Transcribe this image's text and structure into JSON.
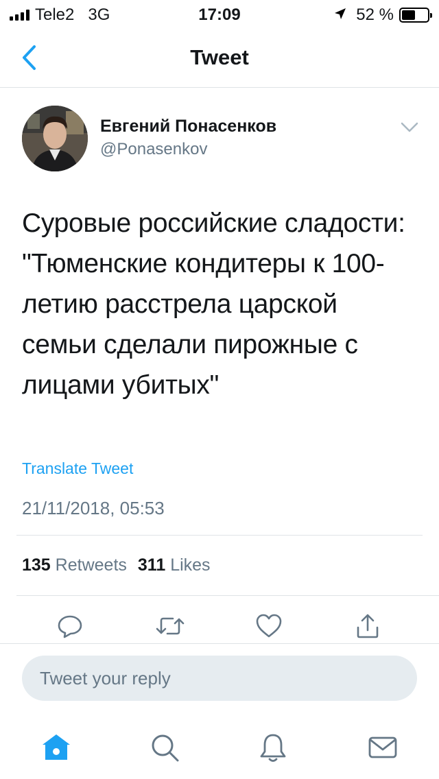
{
  "status_bar": {
    "carrier": "Tele2",
    "network": "3G",
    "time": "17:09",
    "battery": "52 %",
    "battery_level": 0.52
  },
  "nav": {
    "title": "Tweet",
    "back_icon": "chevron-left-icon"
  },
  "tweet": {
    "author_name": "Евгений Понасенков",
    "author_handle": "@Ponasenkov",
    "text": "Суровые российские сладости: \"Тюменские кондитеры к 100-летию расстрела царской семьи сделали пирожные с лицами убитых\"",
    "translate_label": "Translate Tweet",
    "timestamp": "21/11/2018, 05:53",
    "retweets_count": "135",
    "retweets_label": "Retweets",
    "likes_count": "311",
    "likes_label": "Likes"
  },
  "actions": [
    "reply-icon",
    "retweet-icon",
    "like-icon",
    "share-icon"
  ],
  "reply": {
    "placeholder": "Tweet your reply"
  },
  "tab_bar": [
    "home-icon",
    "search-icon",
    "notifications-icon",
    "messages-icon"
  ],
  "colors": {
    "accent": "#1da1f2",
    "secondary_text": "#657786",
    "icon_gray": "#657786",
    "reply_bg": "#e6ecf0"
  }
}
